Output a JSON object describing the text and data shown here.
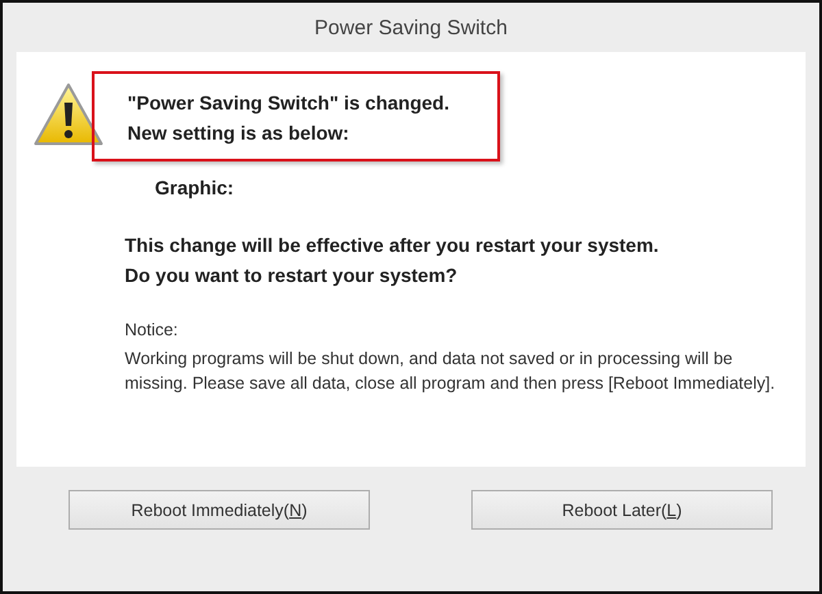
{
  "window": {
    "title": "Power Saving Switch"
  },
  "message": {
    "lines": [
      "\"Power Saving Switch\" is changed.",
      "New setting is as below:"
    ],
    "highlighted": true
  },
  "setting": {
    "label": "Graphic:"
  },
  "question": {
    "lines": [
      "This change will be effective after you restart your system.",
      "Do you want to restart your system?"
    ]
  },
  "notice": {
    "heading": "Notice:",
    "text": "Working programs will be shut down, and data not saved or in processing will be missing. Please save all data, close all program and then press [Reboot Immediately]."
  },
  "buttons": [
    {
      "before": "Reboot Immediately(",
      "mnemonic": "N",
      "after": ")"
    },
    {
      "before": "Reboot Later(",
      "mnemonic": "L",
      "after": ")"
    }
  ]
}
